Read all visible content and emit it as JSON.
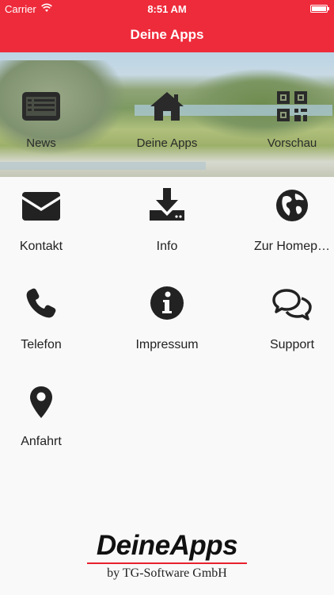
{
  "statusbar": {
    "carrier": "Carrier",
    "time": "8:51 AM"
  },
  "navbar": {
    "title": "Deine Apps"
  },
  "banner": {
    "items": [
      {
        "label": "News",
        "icon": "news-icon"
      },
      {
        "label": "Deine Apps",
        "icon": "home-icon"
      },
      {
        "label": "Vorschau",
        "icon": "qr-code-icon"
      }
    ]
  },
  "grid": {
    "items": [
      {
        "label": "Kontakt",
        "icon": "envelope-icon"
      },
      {
        "label": "Info",
        "icon": "download-icon"
      },
      {
        "label": "Zur Homep…",
        "icon": "globe-icon"
      },
      {
        "label": "Telefon",
        "icon": "phone-icon"
      },
      {
        "label": "Impressum",
        "icon": "info-circle-icon"
      },
      {
        "label": "Support",
        "icon": "chat-bubbles-icon"
      },
      {
        "label": "Anfahrt",
        "icon": "map-marker-icon"
      }
    ]
  },
  "footer": {
    "brand": "DeineApps",
    "byline": "by TG-Software GmbH",
    "accent": "#e8202f"
  },
  "colors": {
    "header": "#ee2b3b",
    "background": "#f9f9f9"
  }
}
